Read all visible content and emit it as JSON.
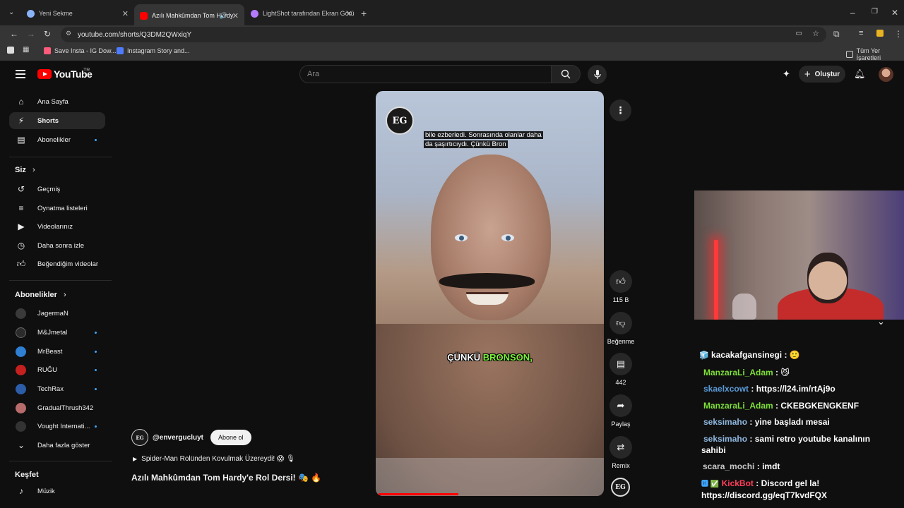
{
  "browser": {
    "tabs": [
      {
        "title": "Yeni Sekme",
        "favicon_color": "#8ab4f8"
      },
      {
        "title": "Azılı Mahkûmdan Tom Hardy",
        "favicon_color": "#ff0000"
      },
      {
        "title": "LightShot tarafından Ekran Görü",
        "favicon_color": "#b57bff"
      }
    ],
    "url": "youtube.com/shorts/Q3DM2QWxiqY",
    "bookmarks": [
      {
        "label": "Save Insta - IG Dow...",
        "color": "#ff5b7a"
      },
      {
        "label": "Instagram Story and...",
        "color": "#4f7bff"
      }
    ],
    "all_bookmarks": "Tüm Yer İşaretleri"
  },
  "header": {
    "logo": "YouTube",
    "country": "TR",
    "search_placeholder": "Ara",
    "create_label": "Oluştur"
  },
  "sidebar": {
    "main": [
      {
        "label": "Ana Sayfa",
        "icon": "home-icon"
      },
      {
        "label": "Shorts",
        "icon": "shorts-icon",
        "active": true
      },
      {
        "label": "Abonelikler",
        "icon": "subscriptions-icon",
        "dot": true
      }
    ],
    "you_heading": "Siz",
    "you": [
      {
        "label": "Geçmiş",
        "icon": "history-icon"
      },
      {
        "label": "Oynatma listeleri",
        "icon": "playlist-icon"
      },
      {
        "label": "Videolarınız",
        "icon": "your-videos-icon"
      },
      {
        "label": "Daha sonra izle",
        "icon": "watch-later-icon"
      },
      {
        "label": "Beğendiğim videolar",
        "icon": "liked-icon"
      }
    ],
    "subs_heading": "Abonelikler",
    "subs": [
      {
        "label": "JagermaN",
        "color": "#3a3a3a",
        "dot": false
      },
      {
        "label": "M&Jmetal",
        "color": "#2b2b2b",
        "dot": true
      },
      {
        "label": "MrBeast",
        "color": "#2f7fd2",
        "dot": true
      },
      {
        "label": "RUĞU",
        "color": "#c42020",
        "dot": true
      },
      {
        "label": "TechRax",
        "color": "#2d5da8",
        "dot": true
      },
      {
        "label": "GradualThrush342",
        "color": "#b86b6b",
        "dot": false
      },
      {
        "label": "Vought Internati...",
        "color": "#333333",
        "dot": true
      }
    ],
    "show_more": "Daha fazla göster",
    "explore_heading": "Keşfet",
    "explore": [
      {
        "label": "Müzik",
        "icon": "music-icon"
      }
    ]
  },
  "video": {
    "caption_top_line1": "bile ezberledi. Sonrasında olanlar daha",
    "caption_top_line2": "da şaşırtıcıydı. Çünkü Bron",
    "caption_mid_white": "ÇÜNKÜ ",
    "caption_mid_green": "BRONSON,",
    "logo_text": "EG",
    "progress": 0.36
  },
  "actions": {
    "like_count": "115 B",
    "dislike_label": "Beğenme",
    "comments_count": "442",
    "share_label": "Paylaş",
    "remix_label": "Remix"
  },
  "meta": {
    "channel": "@envergucluyt",
    "subscribe": "Abone ol",
    "description": "Spider-Man Rolünden Kovulmak Üzereydi! 😱 🎙",
    "title": "Azılı Mahkûmdan Tom Hardy'e Rol Dersi! 🎭 🔥"
  },
  "chat": [
    {
      "user": "kacakafgansinegi",
      "color": "#ffffff",
      "text": "🙂",
      "prefix": "🧊"
    },
    {
      "user": "ManzaraLi_Adam",
      "color": "#7fe03a",
      "text": "😼",
      "prefix": ""
    },
    {
      "user": "skaelxcowt",
      "color": "#5b9bd8",
      "text": "https://l24.im/rtAj9o",
      "prefix": ""
    },
    {
      "user": "ManzaraLi_Adam",
      "color": "#7fe03a",
      "text": "CKEBGKENGKENF",
      "prefix": ""
    },
    {
      "user": "seksimaho",
      "color": "#8fb8e0",
      "text": "yine başladı mesai",
      "prefix": ""
    },
    {
      "user": "seksimaho",
      "color": "#8fb8e0",
      "text": "sami retro youtube kanalının",
      "prefix": ""
    },
    {
      "user": "",
      "color": "#ffffff",
      "text": "sahibi",
      "prefix": ""
    },
    {
      "user": "scara_mochi",
      "color": "#c8c8c8",
      "text": "imdt",
      "prefix": ""
    },
    {
      "user": "KickBot",
      "color": "#ff3f5a",
      "text": "Discord gel la!",
      "prefix": "🅺 ✅"
    },
    {
      "user": "",
      "color": "#ffffff",
      "text": "https://discord.gg/eqT7kvdFQX",
      "prefix": ""
    }
  ]
}
